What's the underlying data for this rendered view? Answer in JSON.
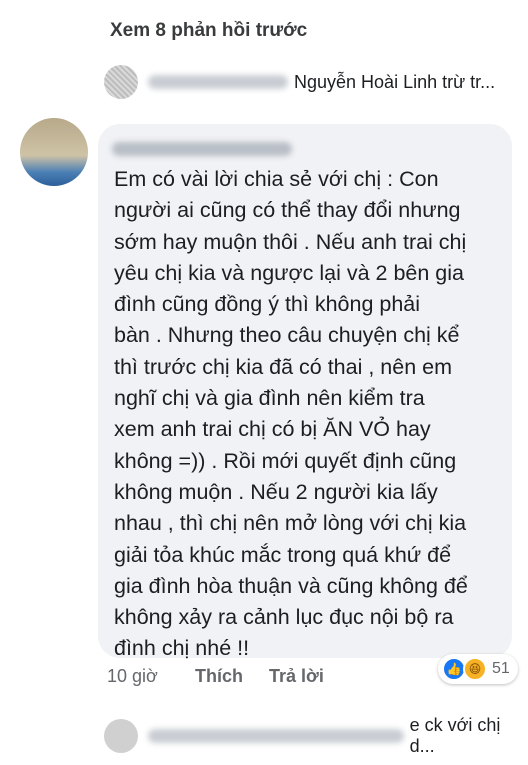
{
  "view_previous": "Xem 8 phản hồi trước",
  "reply_preview": {
    "text": "Nguyễn Hoài Linh trừ tr..."
  },
  "comment": {
    "text": "Em có vài lời chia sẻ với chị : Con\nngười ai cũng có thể thay đổi nhưng\nsớm hay muộn thôi . Nếu anh trai chị\nyêu chị kia và ngược lại  và 2 bên gia\nđình cũng đồng  ý thì không phải\nbàn . Nhưng theo câu chuyện chị kể\nthì trước chị kia đã có thai , nên em\nnghĩ chị và gia đình  nên kiểm tra\nxem anh trai chị có bị ĂN VỎ hay\nkhông =)) . Rồi mới quyết định cũng\nkhông muộn . Nếu 2 người kia lấy\nnhau , thì chị nên mở lòng với chị kia\ngiải tỏa khúc mắc trong quá khứ để\ngia đình hòa thuận và cũng không để\nkhông xảy ra cảnh lục đục nội bộ ra\nđình chị nhé !!",
    "time": "10 giờ",
    "like_label": "Thích",
    "reply_label": "Trả lời",
    "reaction_count": "51"
  },
  "next_reply": {
    "text": "e ck với chị d..."
  },
  "icons": {
    "like": "like-icon",
    "haha": "haha-icon"
  },
  "colors": {
    "bubble": "#f0f2f5",
    "like": "#1877f2",
    "muted": "#65676b"
  }
}
